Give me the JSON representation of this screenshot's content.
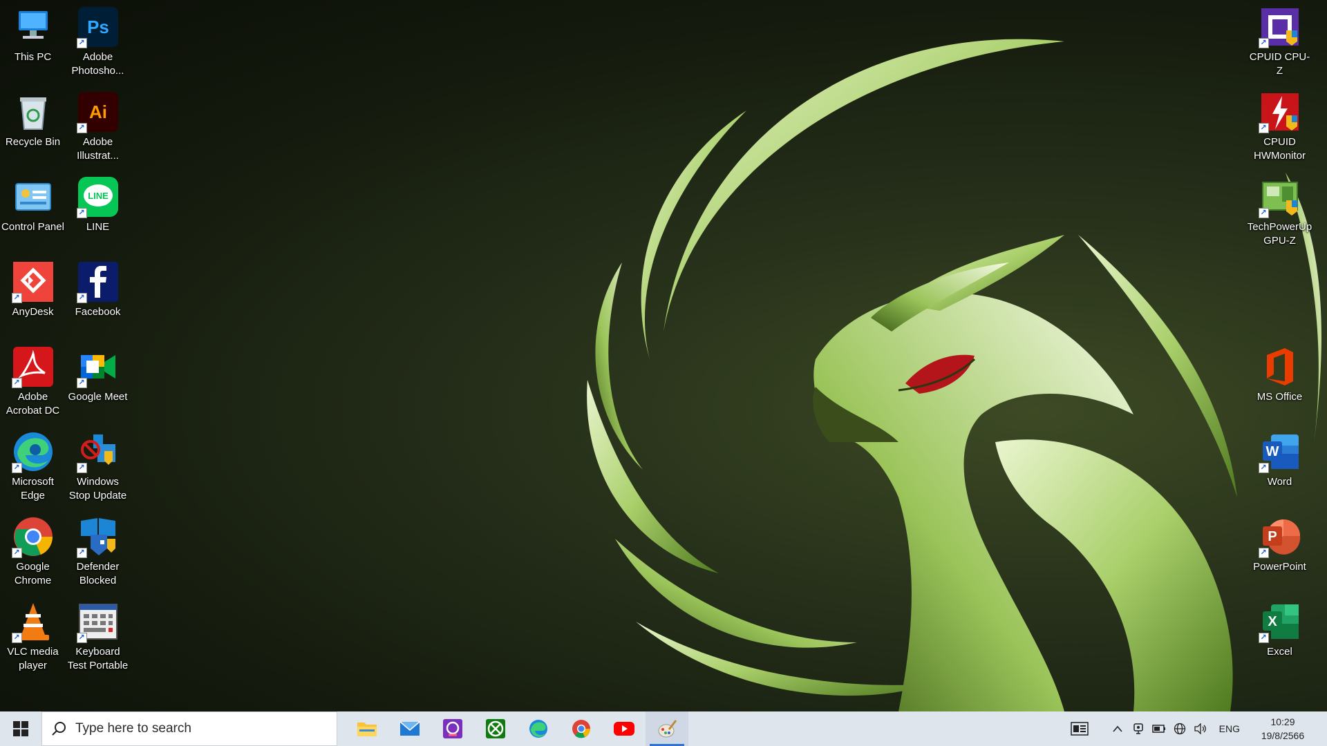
{
  "desktop": {
    "left_col1": [
      {
        "label": "This PC",
        "icon": "this-pc-icon",
        "shortcut": false
      },
      {
        "label": "Recycle Bin",
        "icon": "recycle-bin-icon",
        "shortcut": false
      },
      {
        "label": "Control Panel",
        "icon": "control-panel-icon",
        "shortcut": false
      },
      {
        "label": "AnyDesk",
        "icon": "anydesk-icon",
        "shortcut": true
      },
      {
        "label": "Adobe\nAcrobat DC",
        "icon": "acrobat-icon",
        "shortcut": true
      },
      {
        "label": "Microsoft\nEdge",
        "icon": "edge-icon",
        "shortcut": true
      },
      {
        "label": "Google\nChrome",
        "icon": "chrome-icon",
        "shortcut": true
      },
      {
        "label": "VLC media\nplayer",
        "icon": "vlc-icon",
        "shortcut": true
      }
    ],
    "left_col2": [
      {
        "label": "Adobe\nPhotosho...",
        "icon": "photoshop-icon",
        "shortcut": true
      },
      {
        "label": "Adobe\nIllustrat...",
        "icon": "illustrator-icon",
        "shortcut": true
      },
      {
        "label": "LINE",
        "icon": "line-icon",
        "shortcut": true
      },
      {
        "label": "Facebook",
        "icon": "facebook-icon",
        "shortcut": true
      },
      {
        "label": "Google Meet",
        "icon": "google-meet-icon",
        "shortcut": true
      },
      {
        "label": "Windows\nStop Update",
        "icon": "windows-stop-update-icon",
        "shortcut": true
      },
      {
        "label": "Defender\nBlocked",
        "icon": "defender-blocked-icon",
        "shortcut": true
      },
      {
        "label": "Keyboard\nTest Portable",
        "icon": "keyboard-test-icon",
        "shortcut": true
      }
    ],
    "right_col": [
      {
        "label": "CPUID CPU-Z",
        "icon": "cpu-z-icon",
        "shortcut": true
      },
      {
        "label": "CPUID\nHWMonitor",
        "icon": "hwmonitor-icon",
        "shortcut": true
      },
      {
        "label": "TechPowerUp\nGPU-Z",
        "icon": "gpu-z-icon",
        "shortcut": true
      },
      {
        "label": "MS Office",
        "icon": "ms-office-icon",
        "shortcut": false
      },
      {
        "label": "Word",
        "icon": "word-icon",
        "shortcut": true
      },
      {
        "label": "PowerPoint",
        "icon": "powerpoint-icon",
        "shortcut": true
      },
      {
        "label": "Excel",
        "icon": "excel-icon",
        "shortcut": true
      }
    ]
  },
  "taskbar": {
    "search_placeholder": "Type here to search",
    "pinned": [
      "file-explorer-icon",
      "mail-icon",
      "photo-app-icon",
      "xbox-icon",
      "edge-icon",
      "chrome-icon",
      "youtube-icon",
      "paint-icon"
    ],
    "active_pin": "paint-icon",
    "lang": "ENG",
    "time": "10:29",
    "date": "19/8/2566"
  }
}
